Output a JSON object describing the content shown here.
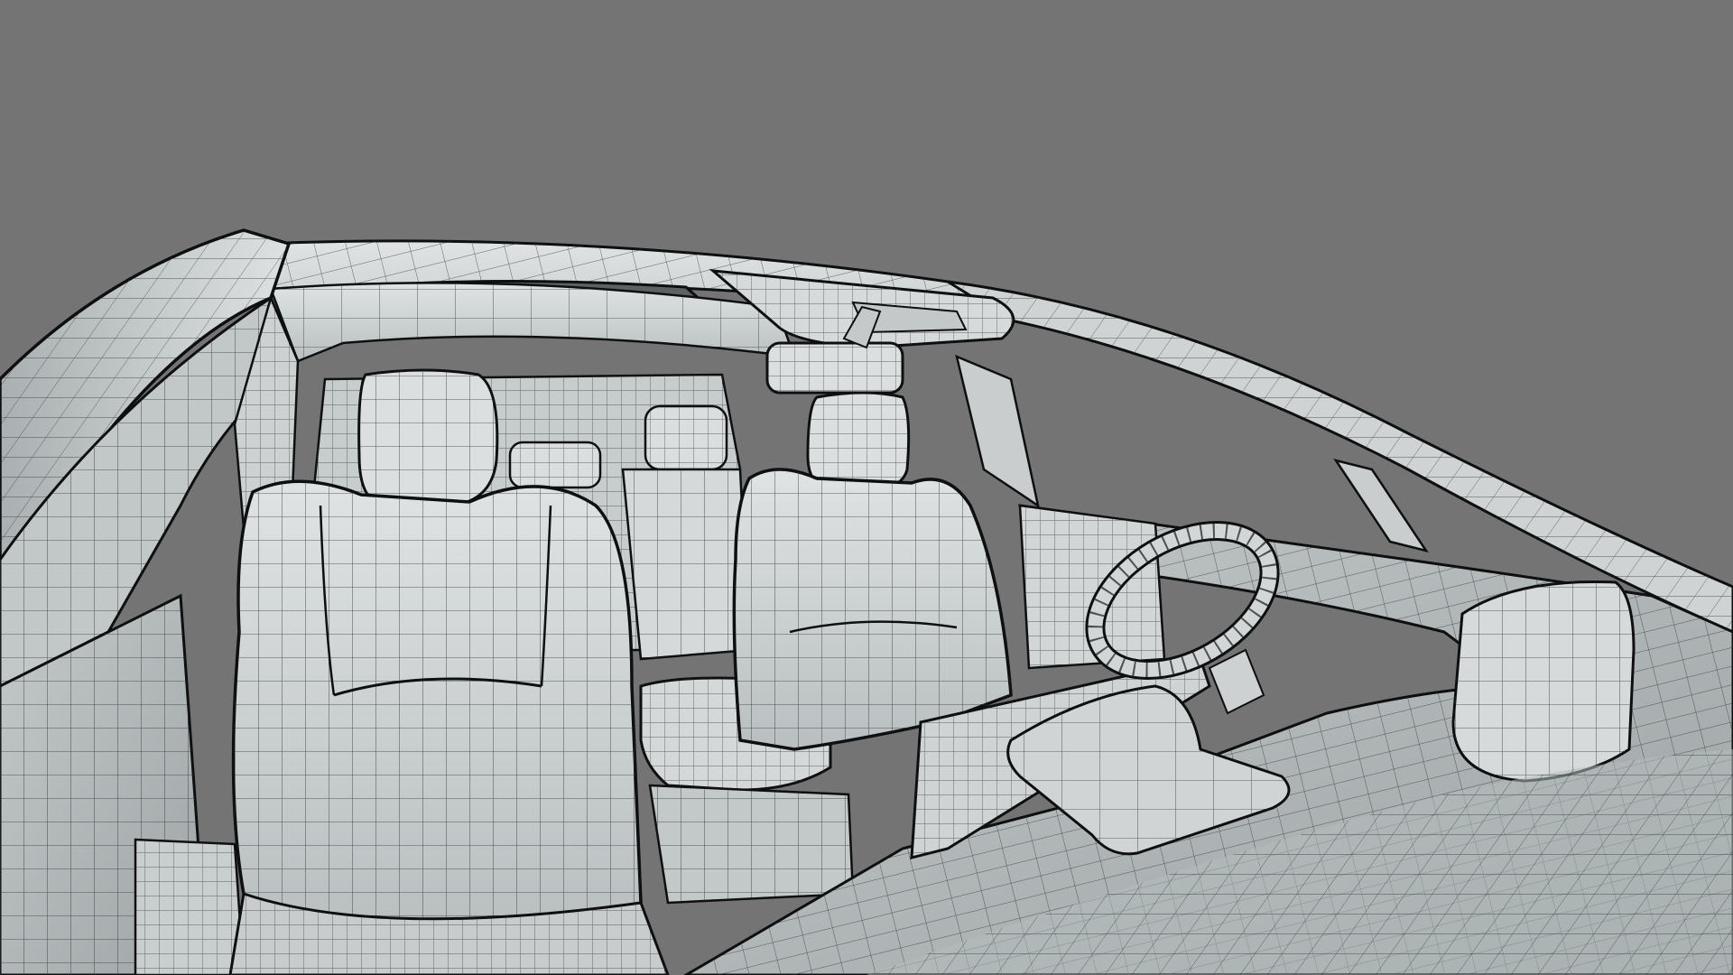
{
  "viewport": {
    "background_color": "#747474",
    "mesh_fill_color": "#d3d7d7",
    "mesh_shadow_color": "#8f9596",
    "wire_color": "#1e2224",
    "edge_color": "#0d0f10"
  },
  "scene": {
    "objects": [
      "roof-frame",
      "sunroof-opening",
      "roof-console",
      "rear-view-mirror",
      "a-pillar",
      "left-door-panel",
      "driver-seat",
      "passenger-seat",
      "rear-seats",
      "center-armrest",
      "steering-wheel",
      "dashboard",
      "center-display",
      "windshield-frame"
    ]
  }
}
